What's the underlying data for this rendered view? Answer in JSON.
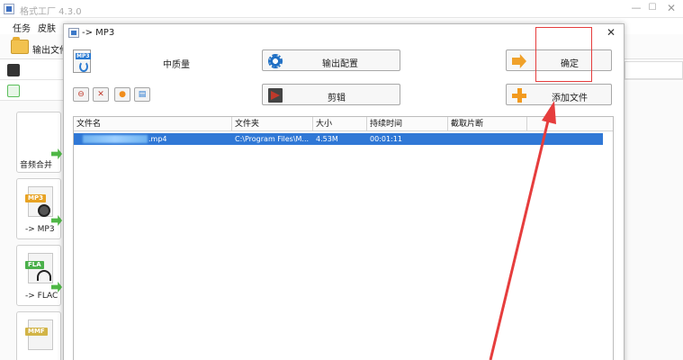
{
  "main_window": {
    "title": "格式工厂 4.3.0",
    "menu": [
      "任务",
      "皮肤"
    ],
    "toolbar_label": "输出文件",
    "tiles": [
      {
        "label": "音频合并"
      },
      {
        "label": "-> MP3",
        "tag": "MP3"
      },
      {
        "label": "-> FLAC",
        "tag": "FLA"
      },
      {
        "label": "",
        "tag": "MMF"
      }
    ]
  },
  "dialog": {
    "title": "-> MP3",
    "quality_label": "中质量",
    "buttons": {
      "output_config": "输出配置",
      "clip": "剪辑",
      "confirm": "确定",
      "add_file": "添加文件"
    },
    "table": {
      "columns": [
        "文件名",
        "文件夹",
        "大小",
        "持续时间",
        "截取片断"
      ],
      "rows": [
        {
          "filename": ".mp4",
          "folder": "C:\\Program Files\\M...",
          "size": "4.53M",
          "duration": "00:01:11",
          "clip": ""
        }
      ]
    }
  },
  "colors": {
    "selection": "#3078d6",
    "annotation": "#e63d3d"
  }
}
